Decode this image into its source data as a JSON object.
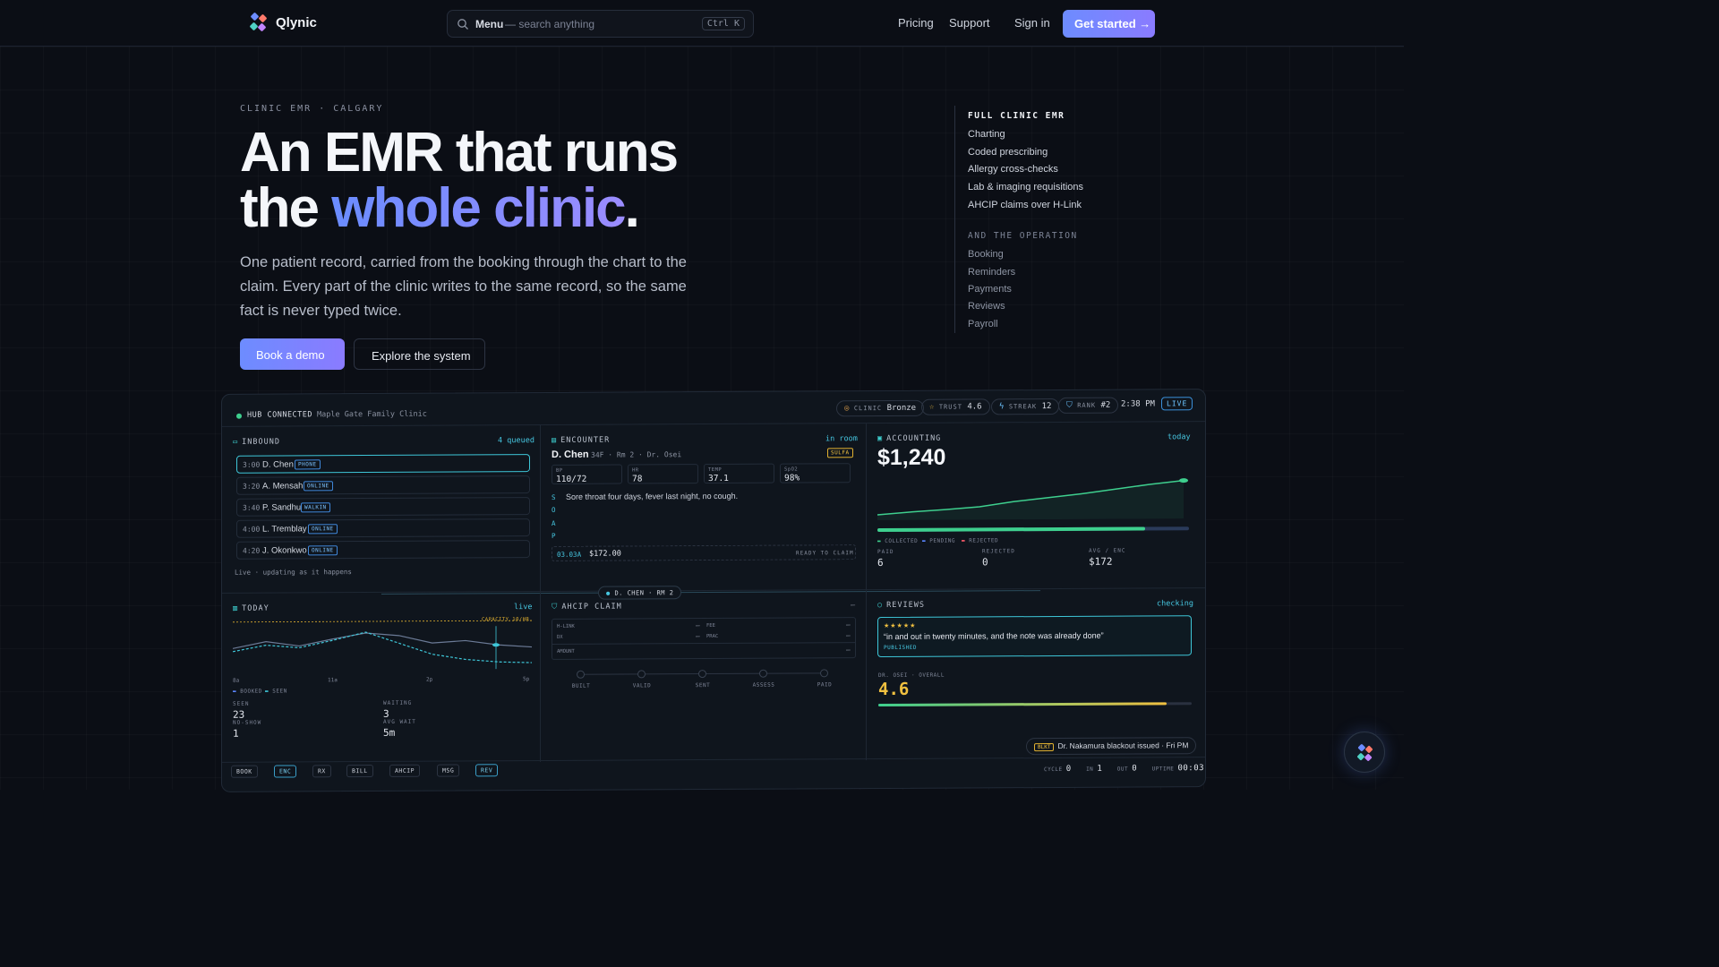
{
  "nav": {
    "brand": "Qlynic",
    "search_label": "Menu",
    "search_placeholder": "— search anything",
    "search_shortcut": "Ctrl K",
    "links": [
      "Pricing",
      "Support",
      "Sign in"
    ],
    "cta": "Get started →"
  },
  "hero": {
    "eyebrow": "CLINIC EMR · CALGARY",
    "title_line1": "An EMR that runs",
    "title_the": "the ",
    "title_accent": "whole clinic",
    "title_dot": ".",
    "lead": "One patient record, carried from the booking through the chart to the claim. Every part of the clinic writes to the same record, so the same fact is never typed twice.",
    "primary_button": "Book a demo",
    "secondary_button": "Explore the system"
  },
  "features": {
    "heading": "FULL CLINIC EMR",
    "items": [
      "Charting",
      "Coded prescribing",
      "Allergy cross-checks",
      "Lab & imaging requisitions",
      "AHCIP claims over H-Link"
    ],
    "ops_heading": "AND THE OPERATION",
    "ops_items": [
      "Booking",
      "Reminders",
      "Payments",
      "Reviews",
      "Payroll"
    ]
  },
  "dashboard": {
    "status": "HUB CONNECTED",
    "clinic_name": "Maple Gate Family Clinic",
    "pills": {
      "clinic_label": "CLINIC",
      "clinic_value": "Bronze",
      "trust_label": "TRUST",
      "trust_value": "4.6",
      "streak_label": "STREAK",
      "streak_value": "12",
      "rank_label": "RANK",
      "rank_value": "#2"
    },
    "time": "2:38 PM",
    "live": "LIVE",
    "inbound": {
      "title": "INBOUND",
      "count": "4 queued",
      "rows": [
        {
          "time": "3:00",
          "name": "D. Chen",
          "tag": "PHONE"
        },
        {
          "time": "3:20",
          "name": "A. Mensah",
          "tag": "ONLINE"
        },
        {
          "time": "3:40",
          "name": "P. Sandhu",
          "tag": "WALKIN"
        },
        {
          "time": "4:00",
          "name": "L. Tremblay",
          "tag": "ONLINE"
        },
        {
          "time": "4:20",
          "name": "J. Okonkwo",
          "tag": "ONLINE"
        }
      ],
      "footer": "Live · updating as it happens"
    },
    "encounter": {
      "title": "ENCOUNTER",
      "status": "in room",
      "patient": "D. Chen",
      "meta": "34F · Rm 2 · Dr. Osei",
      "allergy": "SULFA",
      "vitals": [
        {
          "label": "BP",
          "value": "110/72"
        },
        {
          "label": "HR",
          "value": "78"
        },
        {
          "label": "TEMP",
          "value": "37.1"
        },
        {
          "label": "SpO2",
          "value": "98%"
        }
      ],
      "soap": [
        "S",
        "O",
        "A",
        "P"
      ],
      "subjective": "Sore throat four days, fever last night, no cough.",
      "code": "03.03A",
      "amount": "$172.00",
      "claim_status": "READY TO CLAIM"
    },
    "accounting": {
      "title": "ACCOUNTING",
      "period": "today",
      "total": "$1,240",
      "legend": [
        "COLLECTED",
        "PENDING",
        "REJECTED"
      ],
      "paid_label": "PAID",
      "paid": "6",
      "rejected_label": "REJECTED",
      "rejected": "0",
      "avg_label": "AVG / ENC",
      "avg": "$172",
      "collected_fraction": 0.86,
      "line": [
        0.05,
        0.12,
        0.18,
        0.25,
        0.38,
        0.48,
        0.58,
        0.7,
        0.82,
        0.92
      ]
    },
    "connector": "D. CHEN · RM 2",
    "today": {
      "title": "TODAY",
      "status": "live",
      "capacity": "CAPACITY 10/HR",
      "ticks": [
        "8a",
        "11a",
        "2p",
        "5p"
      ],
      "legend": [
        "BOOKED",
        "SEEN"
      ],
      "booked": [
        0.45,
        0.6,
        0.5,
        0.65,
        0.78,
        0.72,
        0.55,
        0.6,
        0.5,
        0.45
      ],
      "seen": [
        0.38,
        0.52,
        0.46,
        0.62,
        0.8,
        0.55,
        0.3,
        0.18,
        0.12,
        0.1
      ],
      "seen_label": "SEEN",
      "seen_value": "23",
      "waiting_label": "WAITING",
      "waiting_value": "3",
      "noshow_label": "NO-SHOW",
      "noshow_value": "1",
      "avgwait_label": "AVG WAIT",
      "avgwait_value": "5m"
    },
    "claim": {
      "title": "AHCIP CLAIM",
      "status": "–",
      "fields": [
        {
          "label": "H-LINK",
          "value": "–"
        },
        {
          "label": "FEE",
          "value": "–"
        },
        {
          "label": "DX",
          "value": "–"
        },
        {
          "label": "PRAC",
          "value": "–"
        },
        {
          "label": "AMOUNT",
          "value": "–"
        }
      ],
      "steps": [
        "BUILT",
        "VALID",
        "SENT",
        "ASSESS",
        "PAID"
      ]
    },
    "reviews": {
      "title": "REVIEWS",
      "status": "checking",
      "stars": "★★★★★",
      "quote": "“in and out in twenty minutes, and the note was already done”",
      "published": "PUBLISHED",
      "score_label": "DR. OSEI · OVERALL",
      "score": "4.6",
      "score_fraction": 0.92,
      "alert_tag": "BLKT",
      "alert": "Dr. Nakamura blackout issued · Fri PM"
    },
    "modules": [
      "BOOK",
      "ENC",
      "RX",
      "BILL",
      "AHCIP",
      "MSG",
      "REV"
    ],
    "footer": {
      "cycle_label": "CYCLE",
      "cycle": "0",
      "in_label": "IN",
      "in": "1",
      "out_label": "OUT",
      "out": "0",
      "uptime_label": "UPTIME",
      "uptime": "00:03"
    }
  }
}
